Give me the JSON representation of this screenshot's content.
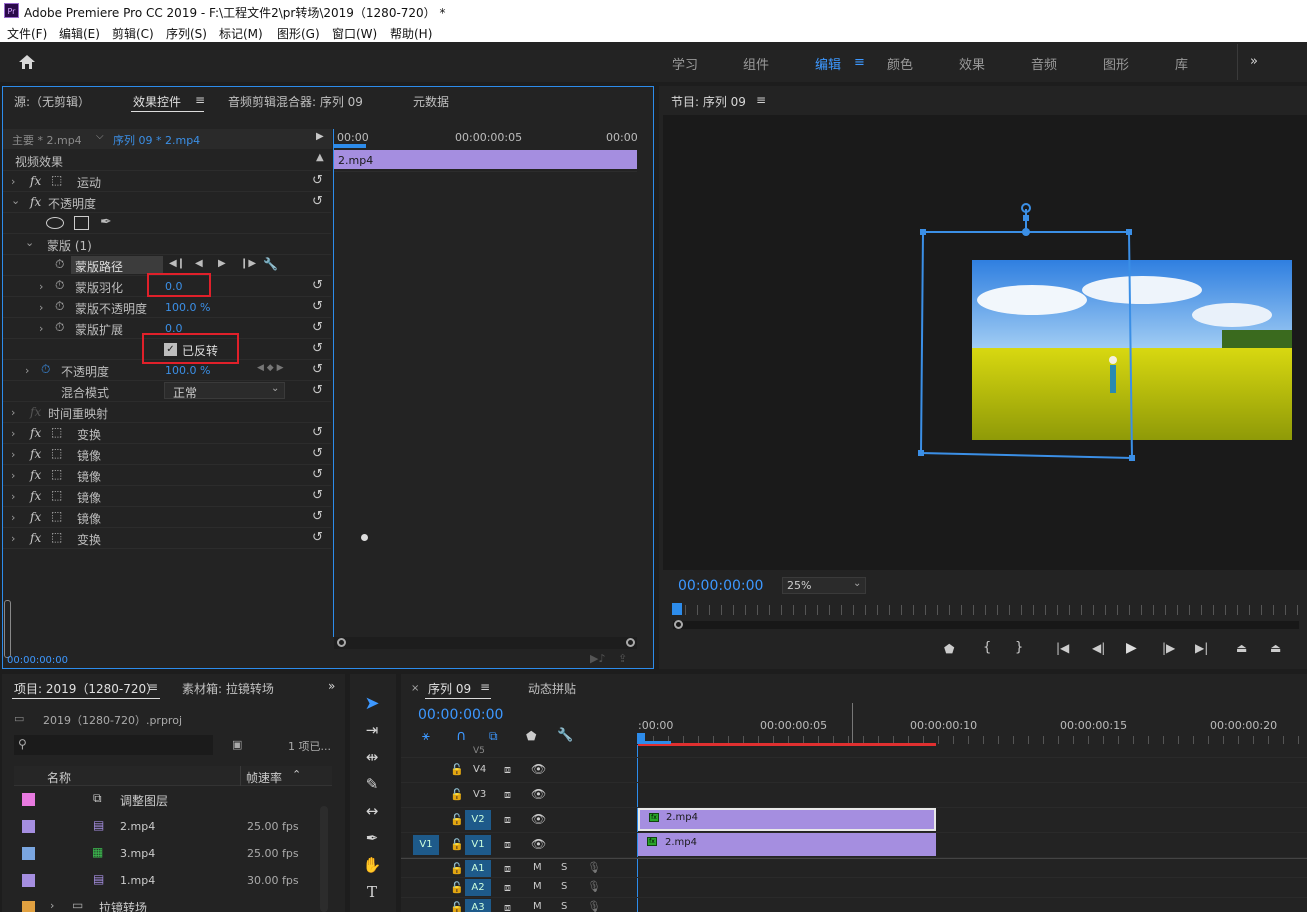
{
  "titlebar": {
    "app_title": "Adobe Premiere Pro CC 2019 - F:\\工程文件2\\pr转场\\2019（1280-720） *"
  },
  "menu": [
    "文件(F)",
    "编辑(E)",
    "剪辑(C)",
    "序列(S)",
    "标记(M)",
    "图形(G)",
    "窗口(W)",
    "帮助(H)"
  ],
  "workspaces": [
    {
      "label": "学习",
      "active": false
    },
    {
      "label": "组件",
      "active": false
    },
    {
      "label": "编辑",
      "active": true
    },
    {
      "label": "颜色",
      "active": false
    },
    {
      "label": "效果",
      "active": false
    },
    {
      "label": "音频",
      "active": false
    },
    {
      "label": "图形",
      "active": false
    },
    {
      "label": "库",
      "active": false
    }
  ],
  "source_panel": {
    "tabs": [
      "源:（无剪辑）",
      "效果控件",
      "音频剪辑混合器: 序列 09",
      "元数据"
    ],
    "active_tab": "效果控件",
    "master_label": "主要 * 2.mp4",
    "sequence_label": "序列 09 * 2.mp4",
    "ruler": [
      "00:00",
      "00:00:00:05",
      "00:00"
    ],
    "clip_label": "2.mp4",
    "section_header": "视频效果",
    "effects": [
      {
        "name": "运动",
        "type": "fx"
      },
      {
        "name": "不透明度",
        "type": "fx"
      }
    ],
    "mask_label": "蒙版 (1)",
    "mask_path_label": "蒙版路径",
    "mask_feather_label": "蒙版羽化",
    "mask_feather_value": "0.0",
    "mask_opacity_label": "蒙版不透明度",
    "mask_opacity_value": "100.0 %",
    "mask_expansion_label": "蒙版扩展",
    "mask_expansion_value": "0.0",
    "inverted_label": "已反转",
    "opacity_label": "不透明度",
    "opacity_value": "100.0 %",
    "blend_label": "混合模式",
    "blend_value": "正常",
    "time_remap_label": "时间重映射",
    "other_effects": [
      "变换",
      "镜像",
      "镜像",
      "镜像",
      "镜像",
      "变换"
    ],
    "timecode": "00:00:00:00"
  },
  "program_panel": {
    "title": "节目: 序列 09",
    "timecode": "00:00:00:00",
    "zoom": "25%"
  },
  "project_panel": {
    "tabs": [
      "项目: 2019（1280-720）",
      "素材箱: 拉镜转场"
    ],
    "project_file": "2019（1280-720）.prproj",
    "item_count": "1 项已...",
    "col_name": "名称",
    "col_fps": "帧速率",
    "items": [
      {
        "name": "调整图层",
        "fps": "",
        "color": "#e87ae0",
        "icon": "adjustment-layer-icon"
      },
      {
        "name": "2.mp4",
        "fps": "25.00 fps",
        "color": "#a58ee0",
        "icon": "video-clip-icon"
      },
      {
        "name": "3.mp4",
        "fps": "25.00 fps",
        "color": "#7aa6e0",
        "icon": "sequence-icon"
      },
      {
        "name": "1.mp4",
        "fps": "30.00 fps",
        "color": "#a58ee0",
        "icon": "video-clip-icon"
      },
      {
        "name": "拉镜转场",
        "fps": "",
        "color": "#e0a040",
        "icon": "folder-icon"
      }
    ]
  },
  "timeline_panel": {
    "tabs": [
      "序列 09",
      "动态拼贴"
    ],
    "timecode": "00:00:00:00",
    "ruler": [
      ":00:00",
      "00:00:00:05",
      "00:00:00:10",
      "00:00:00:15",
      "00:00:00:20"
    ],
    "tracks": [
      {
        "label": "V5",
        "partial": true
      },
      {
        "label": "V4"
      },
      {
        "label": "V3"
      },
      {
        "label": "V2"
      },
      {
        "label": "V1",
        "source": "V1"
      },
      {
        "label": "A1",
        "audio": true
      },
      {
        "label": "A2",
        "audio": true
      },
      {
        "label": "A3",
        "audio": true,
        "partial": true
      }
    ],
    "audio_m": "M",
    "audio_s": "S",
    "clips": [
      {
        "track": "V2",
        "label": "2.mp4"
      },
      {
        "track": "V1",
        "label": "2.mp4"
      }
    ]
  }
}
